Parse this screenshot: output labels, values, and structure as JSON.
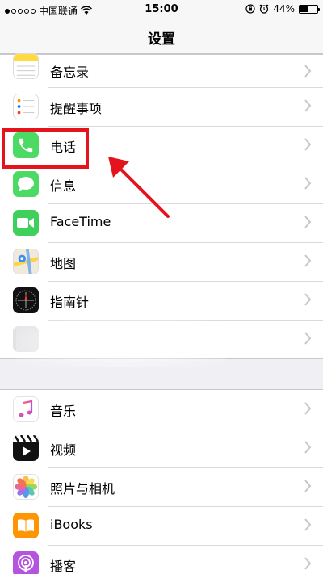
{
  "status_bar": {
    "carrier": "中国联通",
    "time": "15:00",
    "battery": "44%",
    "battery_level": 0.44
  },
  "nav": {
    "title": "设置"
  },
  "group_1": {
    "items": [
      {
        "label": "备忘录",
        "icon": "notes-icon"
      },
      {
        "label": "提醒事项",
        "icon": "reminders-icon"
      },
      {
        "label": "电话",
        "icon": "phone-icon"
      },
      {
        "label": "信息",
        "icon": "messages-icon"
      },
      {
        "label": "FaceTime",
        "icon": "facetime-icon"
      },
      {
        "label": "地图",
        "icon": "maps-icon"
      },
      {
        "label": "指南针",
        "icon": "compass-icon"
      },
      {
        "label": "",
        "icon": ""
      }
    ]
  },
  "group_2": {
    "items": [
      {
        "label": "音乐",
        "icon": "music-icon"
      },
      {
        "label": "视频",
        "icon": "videos-icon"
      },
      {
        "label": "照片与相机",
        "icon": "photos-icon"
      },
      {
        "label": "iBooks",
        "icon": "ibooks-icon"
      },
      {
        "label": "播客",
        "icon": "podcasts-icon"
      }
    ]
  },
  "colors": {
    "phone_green": "#4cd964",
    "facetime_green": "#3ed05a",
    "annotation_red": "#e5131c",
    "ibooks_orange": "#ff9500",
    "podcasts_purple": "#b455e0",
    "background": "#efeff4"
  }
}
